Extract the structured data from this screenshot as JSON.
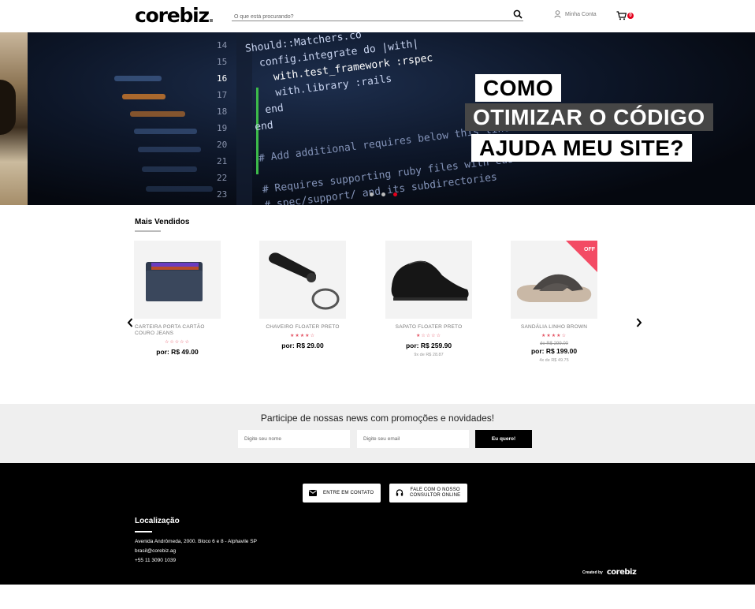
{
  "header": {
    "logo": "corebiz",
    "search_placeholder": "O que está procurando?",
    "account_label": "Minha Conta",
    "cart_count": "0"
  },
  "banner": {
    "headline_1": "COMO",
    "headline_2": "OTIMIZAR O CÓDIGO",
    "headline_3": "AJUDA MEU SITE?",
    "code_lines": [
      "Should::Matchers.co",
      "config.integrate do |with|",
      "with.test_framework :rspec",
      "with.library :rails",
      "end",
      "end",
      "# Add additional requires below this line",
      "# Requires supporting ruby files with custom",
      "# spec/support/ and its subdirectories"
    ],
    "line_numbers": [
      "14",
      "15",
      "16",
      "17",
      "18",
      "19",
      "20",
      "21",
      "22",
      "23"
    ],
    "active_dot": 3
  },
  "best_sellers": {
    "title": "Mais Vendidos",
    "products": [
      {
        "name": "CARTEIRA PORTA CARTÃO COURO JEANS",
        "stars": "☆☆☆☆☆",
        "old_price": "",
        "price": "por: R$ 49.00",
        "installments": ""
      },
      {
        "name": "CHAVEIRO FLOATER PRETO",
        "stars": "★★★★☆",
        "old_price": "",
        "price": "por: R$ 29.00",
        "installments": ""
      },
      {
        "name": "SAPATO FLOATER PRETO",
        "stars": "★☆☆☆☆",
        "old_price": "",
        "price": "por: R$ 259.90",
        "installments": "9x de R$ 28.87"
      },
      {
        "name": "SANDÁLIA LINHO BROWN",
        "stars": "★★★★☆",
        "old_price": "de R$ 299.00",
        "price": "por: R$ 199.00",
        "installments": "4x de R$ 49.75",
        "badge": "OFF"
      }
    ]
  },
  "newsletter": {
    "title": "Participe de nossas news com promoções e novidades!",
    "name_placeholder": "Digite seu nome",
    "email_placeholder": "Digite seu email",
    "button": "Eu quero!"
  },
  "footer": {
    "contact_button": "ENTRE EM CONTATO",
    "consultant_button_1": "FALE COM O NOSSO",
    "consultant_button_2": "CONSULTOR ONLINE",
    "location_title": "Localização",
    "address": "Avenida Andrômeda, 2000. Bloco 6 e 8 - Alphavile SP",
    "email": "brasil@corebiz.ag",
    "phone": "+55 11 3090 1039",
    "created_by": "Created by",
    "credit_logo": "corebiz"
  },
  "colors": {
    "accent": "#e4001b",
    "stars": "#e45565",
    "off_badge": "#f34b64"
  }
}
